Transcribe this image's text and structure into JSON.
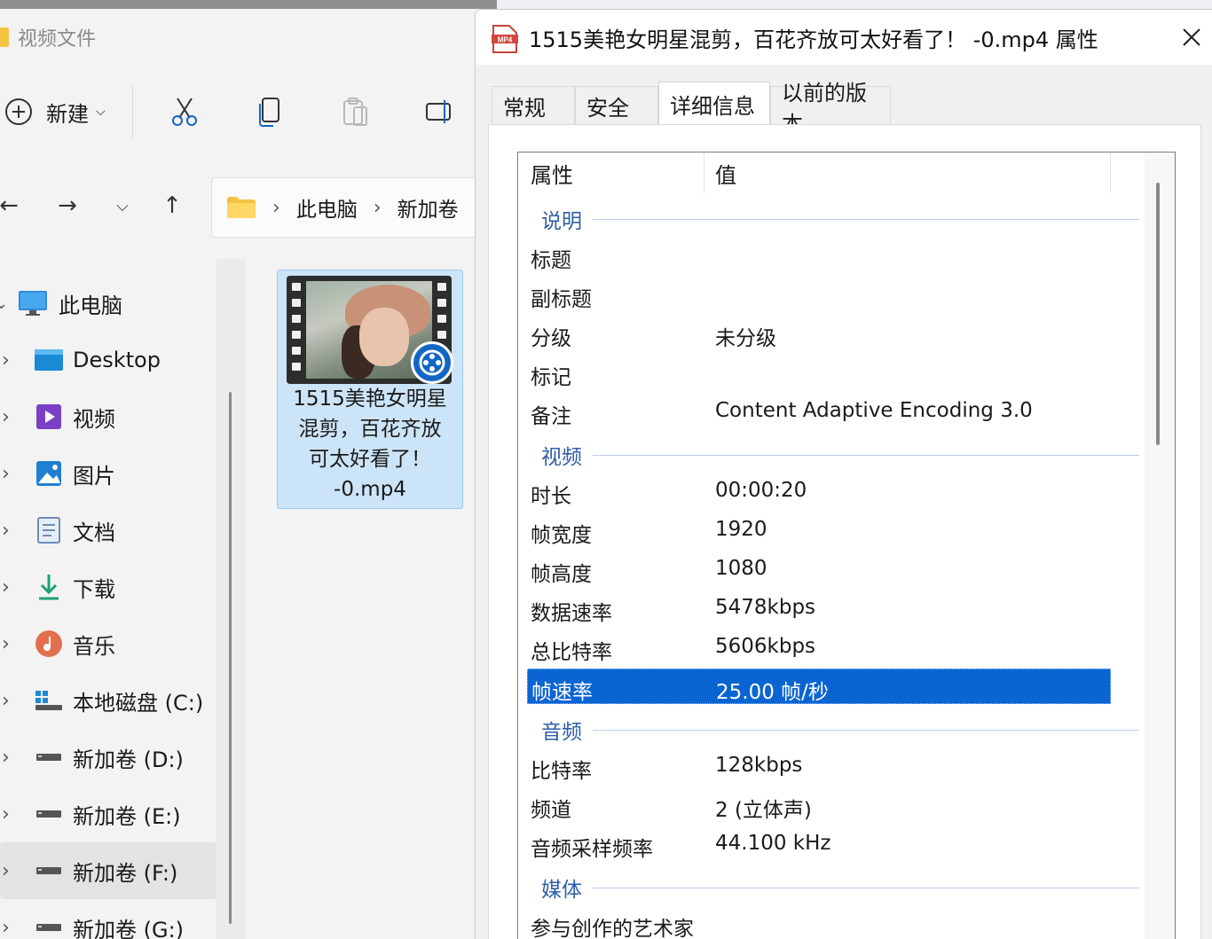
{
  "explorer": {
    "window_title": "视频文件",
    "toolbar": {
      "new_label": "新建"
    },
    "address": {
      "crumbs": [
        "此电脑",
        "新加卷"
      ]
    },
    "sidebar": [
      {
        "label": "此电脑",
        "icon": "monitor-icon"
      },
      {
        "label": "Desktop",
        "icon": "desktop-folder-icon"
      },
      {
        "label": "视频",
        "icon": "videos-folder-icon"
      },
      {
        "label": "图片",
        "icon": "pictures-folder-icon"
      },
      {
        "label": "文档",
        "icon": "documents-folder-icon"
      },
      {
        "label": "下载",
        "icon": "download-icon"
      },
      {
        "label": "音乐",
        "icon": "music-icon"
      },
      {
        "label": "本地磁盘 (C:)",
        "icon": "system-drive-icon"
      },
      {
        "label": "新加卷 (D:)",
        "icon": "drive-icon"
      },
      {
        "label": "新加卷 (E:)",
        "icon": "drive-icon"
      },
      {
        "label": "新加卷 (F:)",
        "icon": "drive-icon"
      },
      {
        "label": "新加卷 (G:)",
        "icon": "drive-icon"
      }
    ],
    "file": {
      "name_lines": [
        "1515美艳女明星",
        "混剪，百花齐放",
        "可太好看了！",
        "-0.mp4"
      ]
    }
  },
  "dialog": {
    "title": "1515美艳女明星混剪，百花齐放可太好看了！ -0.mp4 属性",
    "file_icon_text": "MP4",
    "tabs": [
      "常规",
      "安全",
      "详细信息",
      "以前的版本"
    ],
    "active_tab": "详细信息",
    "list": {
      "header": {
        "property": "属性",
        "value": "值"
      },
      "groups": [
        {
          "title": "说明",
          "rows": [
            {
              "k": "标题",
              "v": ""
            },
            {
              "k": "副标题",
              "v": ""
            },
            {
              "k": "分级",
              "v": "未分级"
            },
            {
              "k": "标记",
              "v": ""
            },
            {
              "k": "备注",
              "v": "Content Adaptive Encoding 3.0"
            }
          ]
        },
        {
          "title": "视频",
          "rows": [
            {
              "k": "时长",
              "v": "00:00:20"
            },
            {
              "k": "帧宽度",
              "v": "1920"
            },
            {
              "k": "帧高度",
              "v": "1080"
            },
            {
              "k": "数据速率",
              "v": "5478kbps"
            },
            {
              "k": "总比特率",
              "v": "5606kbps"
            },
            {
              "k": "帧速率",
              "v": "25.00 帧/秒",
              "selected": true
            }
          ]
        },
        {
          "title": "音频",
          "rows": [
            {
              "k": "比特率",
              "v": "128kbps"
            },
            {
              "k": "频道",
              "v": "2 (立体声)"
            },
            {
              "k": "音频采样频率",
              "v": "44.100 kHz"
            }
          ]
        },
        {
          "title": "媒体",
          "rows": [
            {
              "k": "参与创作的艺术家",
              "v": ""
            }
          ]
        }
      ]
    }
  },
  "colors": {
    "selection": "#0a64d2",
    "group_title": "#2f5ea8",
    "accent_icon": "#1366c6"
  }
}
